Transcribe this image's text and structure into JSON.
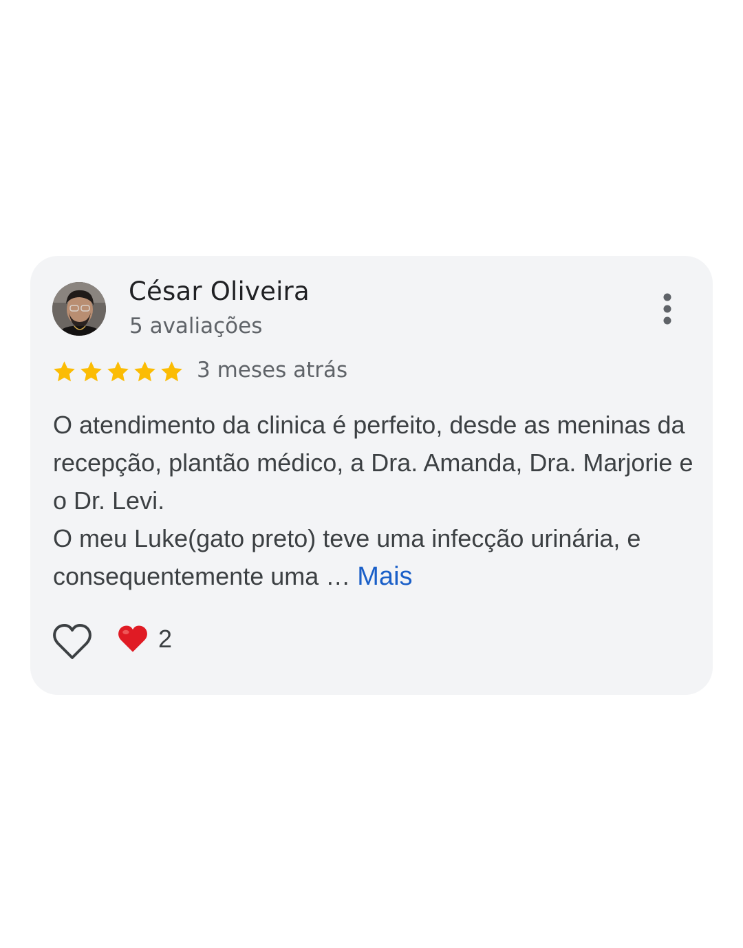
{
  "review": {
    "author_name": "César Oliveira",
    "author_reviews": "5 avaliações",
    "rating": 5,
    "rating_max": 5,
    "date": "3 meses atrás",
    "text_paragraph_1": "O atendimento da clinica é perfeito, desde as meninas da recepção, plantão médico, a Dra. Amanda, Dra. Marjorie e o Dr. Levi.",
    "text_paragraph_2": "O meu Luke(gato preto) teve uma infecção urinária, e consequentemente uma …",
    "more_label": "Mais",
    "reaction_count": "2"
  },
  "icons": {
    "menu": "more-vert-icon",
    "like": "heart-outline-icon",
    "reaction": "red-heart-icon",
    "star": "star-icon"
  },
  "colors": {
    "card_background": "#f3f4f6",
    "star": "#fbbc04",
    "link": "#1a5fc8",
    "heart": "#e01b24"
  }
}
